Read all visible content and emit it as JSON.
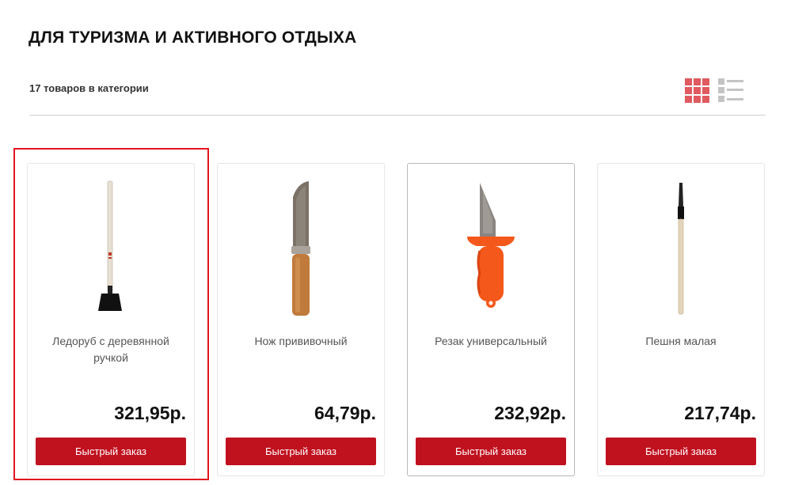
{
  "header": {
    "title": "ДЛЯ ТУРИЗМА И АКТИВНОГО ОТДЫХА",
    "count_text": "17 товаров в категории"
  },
  "view_toggle": {
    "active": "grid",
    "colors": {
      "active": "#e05a5f",
      "inactive": "#c4c4c4"
    }
  },
  "products": [
    {
      "name": "Ледоруб с деревянной ручкой",
      "price": "321,95р.",
      "button": "Быстрый заказ",
      "image_icon": "ice-pick-icon"
    },
    {
      "name": "Нож прививочный",
      "price": "64,79р.",
      "button": "Быстрый заказ",
      "image_icon": "grafting-knife-icon"
    },
    {
      "name": "Резак универсальный",
      "price": "232,92р.",
      "button": "Быстрый заказ",
      "image_icon": "utility-cutter-icon"
    },
    {
      "name": "Пешня малая",
      "price": "217,74р.",
      "button": "Быстрый заказ",
      "image_icon": "ice-chisel-icon"
    }
  ],
  "colors": {
    "accent": "#c0111f",
    "highlight": "#e3141f"
  }
}
